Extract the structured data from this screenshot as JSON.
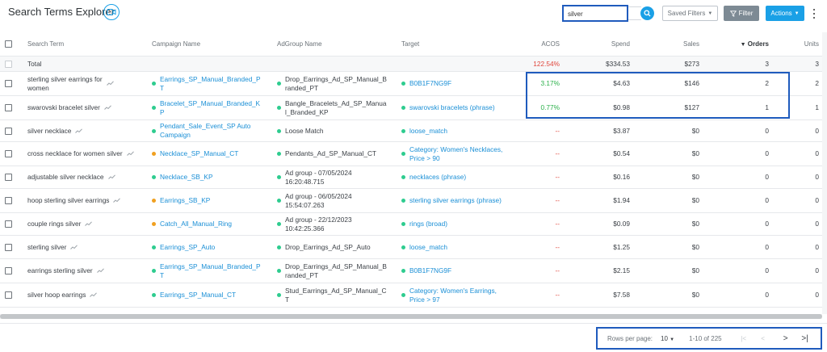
{
  "header": {
    "title": "Search Terms Explorer",
    "search_value": "silver",
    "saved_filters_label": "Saved Filters",
    "filter_label": "Filter",
    "actions_label": "Actions"
  },
  "columns": {
    "search_term": "Search Term",
    "campaign": "Campaign Name",
    "adgroup": "AdGroup Name",
    "target": "Target",
    "acos": "ACOS",
    "spend": "Spend",
    "sales": "Sales",
    "orders": "Orders",
    "units": "Units"
  },
  "total": {
    "label": "Total",
    "acos": "122.54%",
    "spend": "$334.53",
    "sales": "$273",
    "orders": "3",
    "units": "3"
  },
  "rows": [
    {
      "term": [
        "sterling silver earrings for",
        "women"
      ],
      "campaign": [
        "Earrings_SP_Manual_Branded_P",
        "T"
      ],
      "campaign_dot": "#2ecc8f",
      "adgroup": [
        "Drop_Earrings_Ad_SP_Manual_B",
        "randed_PT"
      ],
      "target": [
        "B0B1F7NG9F"
      ],
      "acos": "3.17%",
      "spend": "$4.63",
      "sales": "$146",
      "orders": "2",
      "units": "2"
    },
    {
      "term": [
        "swarovski bracelet silver"
      ],
      "campaign": [
        "Bracelet_SP_Manual_Branded_K",
        "P"
      ],
      "campaign_dot": "#2ecc8f",
      "adgroup": [
        "Bangle_Bracelets_Ad_SP_Manua",
        "l_Branded_KP"
      ],
      "target": [
        "swarovski bracelets (phrase)"
      ],
      "acos": "0.77%",
      "spend": "$0.98",
      "sales": "$127",
      "orders": "1",
      "units": "1"
    },
    {
      "term": [
        "silver necklace"
      ],
      "campaign": [
        "Pendant_Sale_Event_SP Auto",
        "Campaign"
      ],
      "campaign_dot": "#2ecc8f",
      "adgroup": [
        "Loose Match"
      ],
      "target": [
        "loose_match"
      ],
      "acos": "--",
      "spend": "$3.87",
      "sales": "$0",
      "orders": "0",
      "units": "0"
    },
    {
      "term": [
        "cross necklace for women silver"
      ],
      "campaign": [
        "Necklace_SP_Manual_CT"
      ],
      "campaign_dot": "#f0a020",
      "adgroup": [
        "Pendants_Ad_SP_Manual_CT"
      ],
      "target": [
        "Category: Women's Necklaces,",
        "Price > 90"
      ],
      "acos": "--",
      "spend": "$0.54",
      "sales": "$0",
      "orders": "0",
      "units": "0"
    },
    {
      "term": [
        "adjustable silver necklace"
      ],
      "campaign": [
        "Necklace_SB_KP"
      ],
      "campaign_dot": "#2ecc8f",
      "adgroup": [
        "Ad group - 07/05/2024",
        "16:20:48.715"
      ],
      "target": [
        "necklaces (phrase)"
      ],
      "acos": "--",
      "spend": "$0.16",
      "sales": "$0",
      "orders": "0",
      "units": "0"
    },
    {
      "term": [
        "hoop sterling silver earrings"
      ],
      "campaign": [
        "Earrings_SB_KP"
      ],
      "campaign_dot": "#f0a020",
      "adgroup": [
        "Ad group - 06/05/2024",
        "15:54:07.263"
      ],
      "target": [
        "sterling silver earrings (phrase)"
      ],
      "acos": "--",
      "spend": "$1.94",
      "sales": "$0",
      "orders": "0",
      "units": "0"
    },
    {
      "term": [
        "couple rings silver"
      ],
      "campaign": [
        "Catch_All_Manual_Ring"
      ],
      "campaign_dot": "#f0a020",
      "adgroup": [
        "Ad group - 22/12/2023",
        "10:42:25.366"
      ],
      "target": [
        "rings (broad)"
      ],
      "acos": "--",
      "spend": "$0.09",
      "sales": "$0",
      "orders": "0",
      "units": "0"
    },
    {
      "term": [
        "sterling silver"
      ],
      "campaign": [
        "Earrings_SP_Auto"
      ],
      "campaign_dot": "#2ecc8f",
      "adgroup": [
        "Drop_Earrings_Ad_SP_Auto"
      ],
      "target": [
        "loose_match"
      ],
      "acos": "--",
      "spend": "$1.25",
      "sales": "$0",
      "orders": "0",
      "units": "0"
    },
    {
      "term": [
        "earrings sterling silver"
      ],
      "campaign": [
        "Earrings_SP_Manual_Branded_P",
        "T"
      ],
      "campaign_dot": "#2ecc8f",
      "adgroup": [
        "Drop_Earrings_Ad_SP_Manual_B",
        "randed_PT"
      ],
      "target": [
        "B0B1F7NG9F"
      ],
      "acos": "--",
      "spend": "$2.15",
      "sales": "$0",
      "orders": "0",
      "units": "0"
    },
    {
      "term": [
        "silver hoop earrings"
      ],
      "campaign": [
        "Earrings_SP_Manual_CT"
      ],
      "campaign_dot": "#2ecc8f",
      "adgroup": [
        "Stud_Earrings_Ad_SP_Manual_C",
        "T"
      ],
      "target": [
        "Category: Women's Earrings,",
        "Price > 97"
      ],
      "acos": "--",
      "spend": "$7.58",
      "sales": "$0",
      "orders": "0",
      "units": "0"
    }
  ],
  "pagination": {
    "rows_per_page_label": "Rows per page:",
    "rows_per_page": "10",
    "range": "1-10 of 225"
  },
  "colors": {
    "accent": "#1aa0e6",
    "link": "#1a8fd6",
    "positive": "#2bb04a",
    "negative": "#e0453a",
    "highlight": "#1f5bbd"
  }
}
